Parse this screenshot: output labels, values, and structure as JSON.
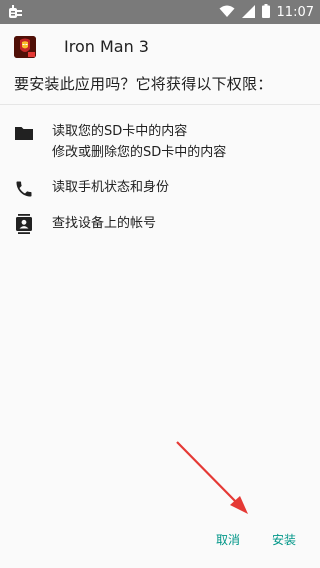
{
  "status_bar": {
    "time": "11:07",
    "icons": [
      "debug-bug-icon",
      "wifi-icon",
      "signal-icon",
      "battery-icon"
    ]
  },
  "app": {
    "name": "Iron Man 3",
    "icon": "iron-man-app-icon"
  },
  "prompt": "要安装此应用吗？它将获得以下权限：",
  "permissions": [
    {
      "icon": "folder-icon",
      "lines": [
        "读取您的SD卡中的内容",
        "修改或删除您的SD卡中的内容"
      ]
    },
    {
      "icon": "phone-icon",
      "lines": [
        "读取手机状态和身份"
      ]
    },
    {
      "icon": "contact-icon",
      "lines": [
        "查找设备上的帐号"
      ]
    }
  ],
  "buttons": {
    "cancel": "取消",
    "install": "安装"
  },
  "colors": {
    "status_bar": "#7a7a7a",
    "accent": "#009688",
    "annotation_arrow": "#e53935"
  }
}
